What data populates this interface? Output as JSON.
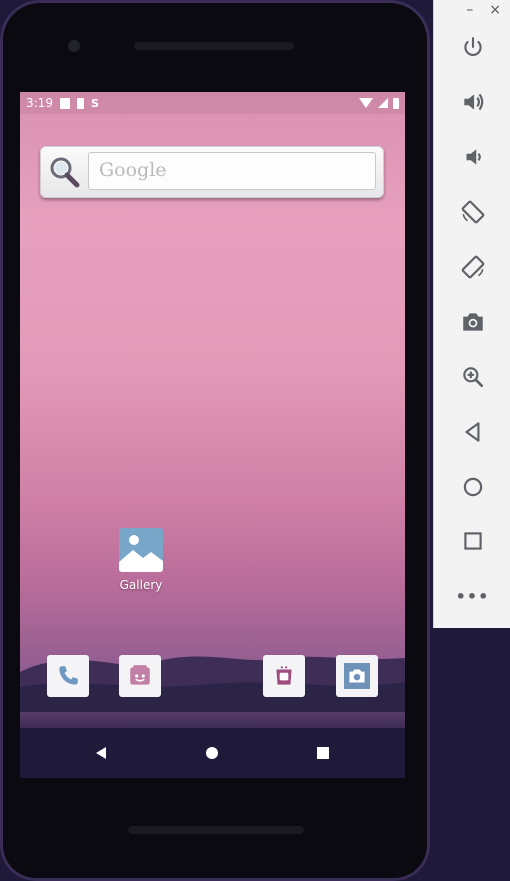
{
  "status_bar": {
    "time": "3:19",
    "s_badge": "S"
  },
  "search_widget": {
    "placeholder": "Google"
  },
  "home": {
    "gallery_label": "Gallery"
  },
  "dock": {
    "items": [
      "phone-app",
      "messaging-app",
      "app-store",
      "camera-app"
    ]
  },
  "emulator": {
    "window_controls": {
      "minimize": "–",
      "close": "×"
    },
    "more_label": "•••"
  },
  "colors": {
    "wallpaper_top": "#e6a0bd",
    "wallpaper_bottom": "#25203f",
    "gallery_icon": "#78a6c8",
    "toolbar_icon": "#5f6368",
    "device_frame_accent": "#3a2e58"
  }
}
